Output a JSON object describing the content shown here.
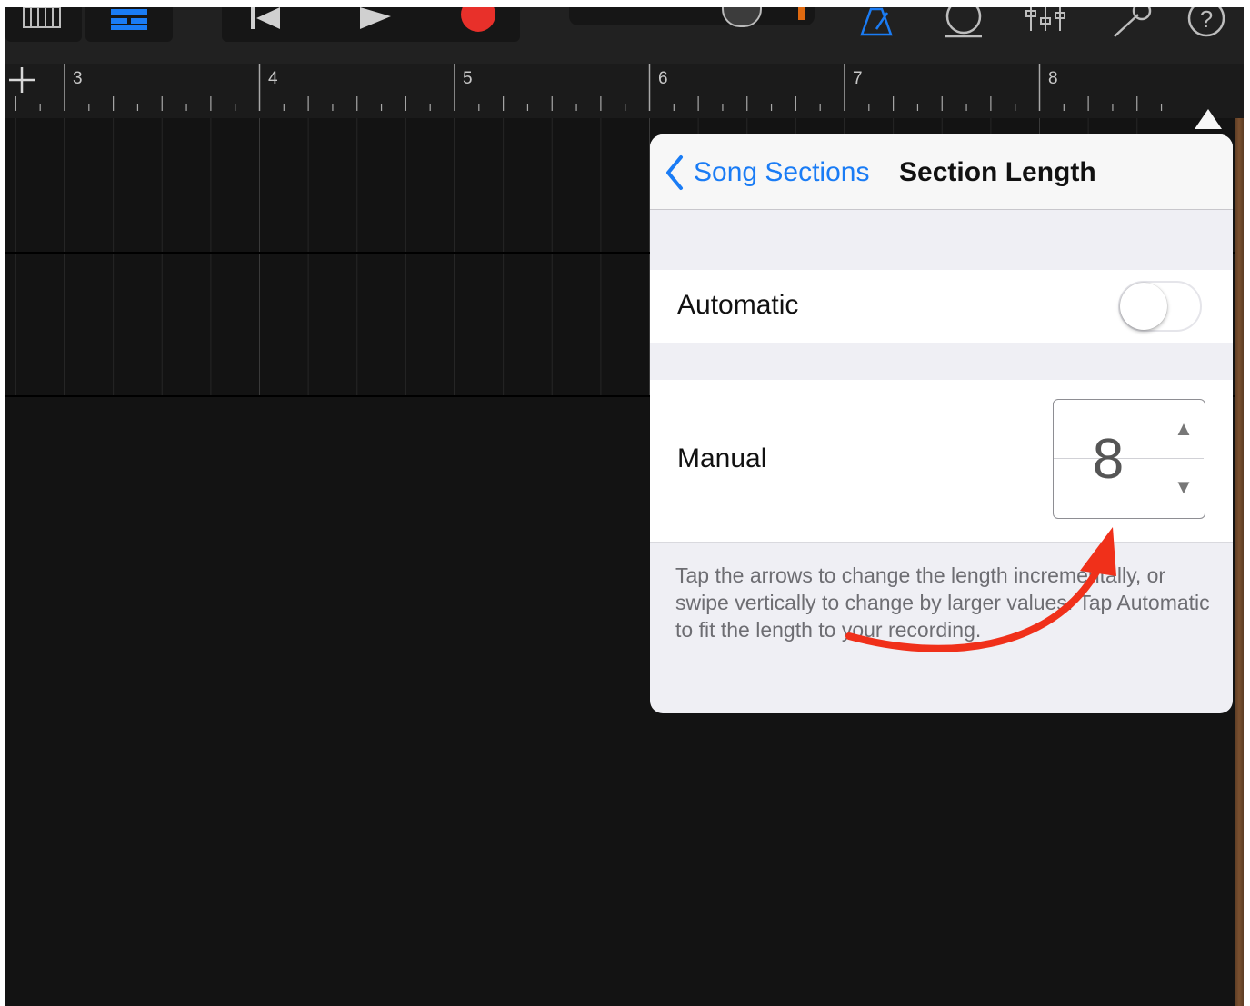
{
  "ruler": {
    "bars": [
      "3",
      "4",
      "5",
      "6",
      "7",
      "8"
    ]
  },
  "popover": {
    "back_label": "Song Sections",
    "title": "Section Length",
    "automatic_label": "Automatic",
    "automatic_on": false,
    "manual_label": "Manual",
    "manual_value": "8",
    "step_up": "▲",
    "step_down": "▼",
    "help_text": "Tap the arrows to change the length incrementally, or swipe vertically to change by larger values. Tap Automatic to fit the length to your recording."
  },
  "icons": {
    "toolbar": [
      "keyboard-icon",
      "tracks-view-icon",
      "rewind-icon",
      "play-icon",
      "record-icon",
      "volume-slider",
      "metronome-icon",
      "loop-icon",
      "mixer-icon",
      "settings-wrench-icon",
      "help-icon"
    ],
    "ruler_add": "plus-icon"
  },
  "colors": {
    "accent_blue": "#1a7cf5",
    "record_red": "#e8302a",
    "callout_red": "#f0301a"
  }
}
